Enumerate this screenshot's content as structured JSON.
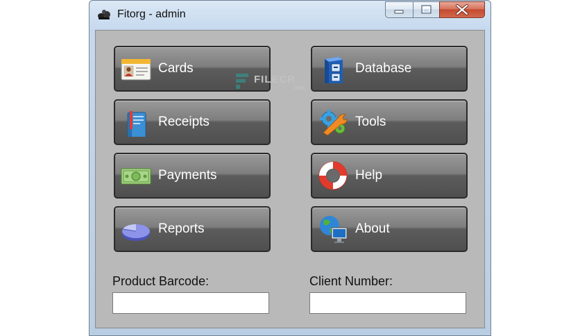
{
  "window": {
    "title": "Fitorg - admin"
  },
  "buttons": {
    "cards": "Cards",
    "database": "Database",
    "receipts": "Receipts",
    "tools": "Tools",
    "payments": "Payments",
    "help": "Help",
    "reports": "Reports",
    "about": "About"
  },
  "fields": {
    "product_barcode_label": "Product Barcode:",
    "product_barcode_value": "",
    "client_number_label": "Client Number:",
    "client_number_value": ""
  },
  "watermark": {
    "brand": "FILECR",
    "suffix": ".com"
  },
  "icons": {
    "app": "app-logo-icon",
    "cards": "id-card-icon",
    "database": "filing-cabinet-icon",
    "receipts": "book-icon",
    "tools": "gears-wrench-icon",
    "payments": "banknote-icon",
    "help": "lifebuoy-icon",
    "reports": "pie-chart-icon",
    "about": "globe-monitor-icon"
  }
}
